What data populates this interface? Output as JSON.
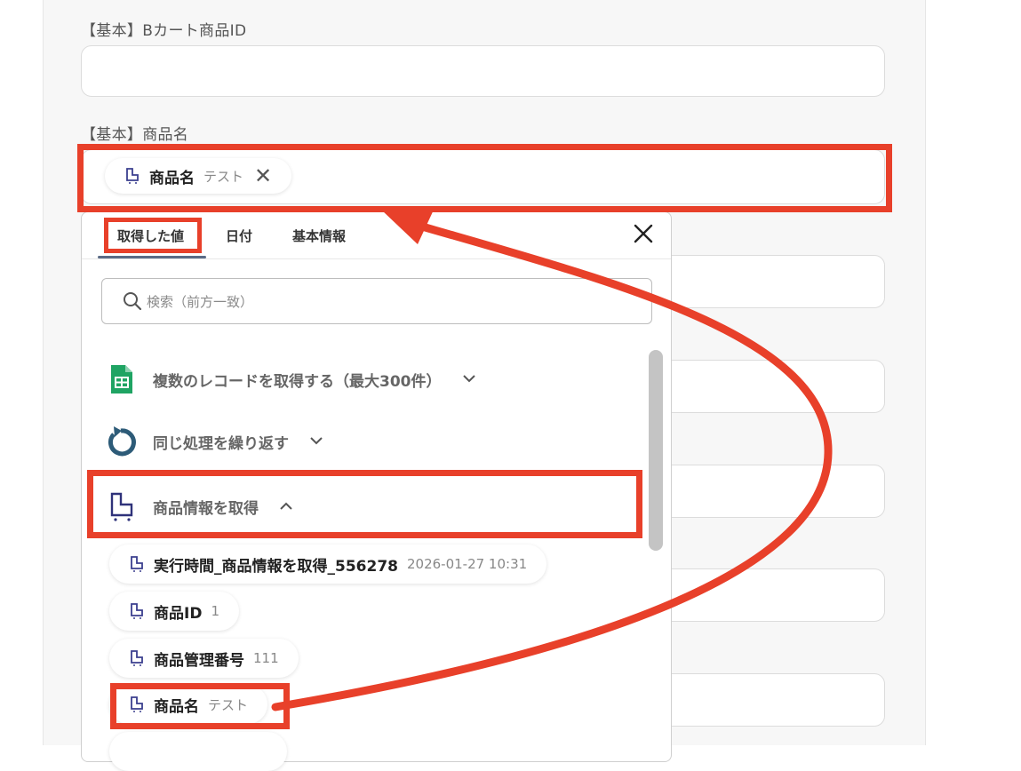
{
  "form": {
    "field1_label": "【基本】Bカート商品ID",
    "field2_label": "【基本】商品名",
    "field2_chip": {
      "name": "商品名",
      "value": "テスト"
    }
  },
  "picker": {
    "tabs": [
      "取得した値",
      "日付",
      "基本情報"
    ],
    "active_tab": "取得した値",
    "search_placeholder": "検索（前方一致）",
    "sections": [
      {
        "label": "複数のレコードを取得する（最大300件）",
        "icon": "spreadsheet-icon",
        "expanded": false
      },
      {
        "label": "同じ処理を繰り返す",
        "icon": "loop-icon",
        "expanded": false
      },
      {
        "label": "商品情報を取得",
        "icon": "cart-icon",
        "expanded": true
      }
    ],
    "items": [
      {
        "name": "実行時間_商品情報を取得_556278",
        "value": "2026-01-27 10:31"
      },
      {
        "name": "商品ID",
        "value": "1"
      },
      {
        "name": "商品管理番号",
        "value": "111"
      },
      {
        "name": "商品名",
        "value": "テスト"
      }
    ]
  },
  "colors": {
    "annotation_red": "#e8402a",
    "tab_underline": "#5a6b86"
  }
}
